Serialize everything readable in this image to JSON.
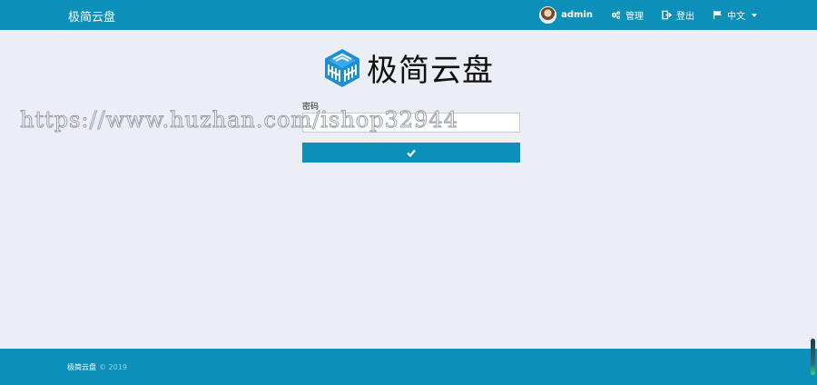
{
  "navbar": {
    "brand": "极简云盘",
    "user": "admin",
    "manage_label": "管理",
    "logout_label": "登出",
    "language_label": "中文"
  },
  "logo": {
    "title": "极简云盘"
  },
  "form": {
    "password_label": "密码",
    "password_value": "",
    "submit_icon": "check-icon"
  },
  "watermark": "https://www.huzhan.com/ishop32944",
  "footer": {
    "name": "极简云盘",
    "copyright": "© 2019"
  },
  "colors": {
    "primary": "#0c90ba",
    "background": "#ebeef4",
    "logo_blue": "#1a8fd6"
  }
}
